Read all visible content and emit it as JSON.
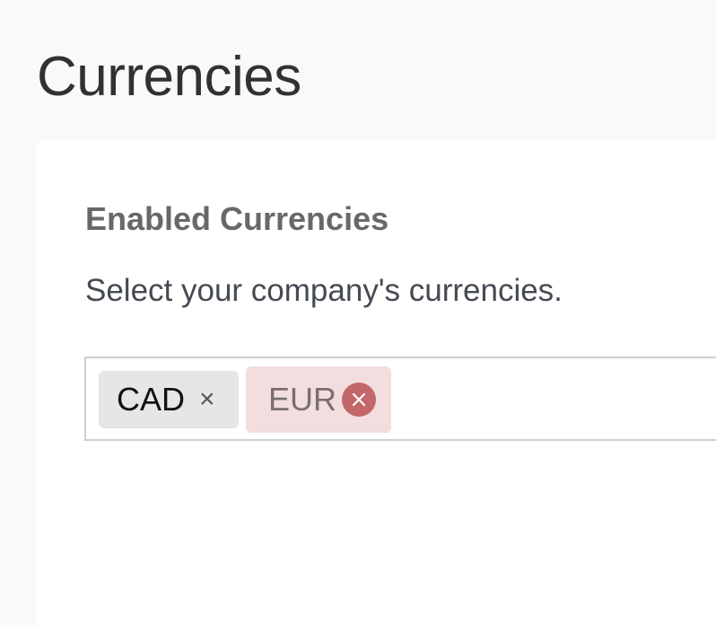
{
  "page": {
    "title": "Currencies"
  },
  "card": {
    "section_title": "Enabled Currencies",
    "description": "Select your company's currencies.",
    "tags": [
      {
        "label": "CAD",
        "remove_glyph": "×",
        "state": "normal"
      },
      {
        "label": "EUR",
        "remove_icon": "close-circle-icon",
        "state": "highlighted"
      }
    ]
  },
  "colors": {
    "page_background": "#f8f9fb",
    "card_background": "#ffffff",
    "tag_normal_background": "#e6e6e6",
    "tag_highlight_background": "#f2dede",
    "tag_highlight_remove": "#c4676a"
  }
}
